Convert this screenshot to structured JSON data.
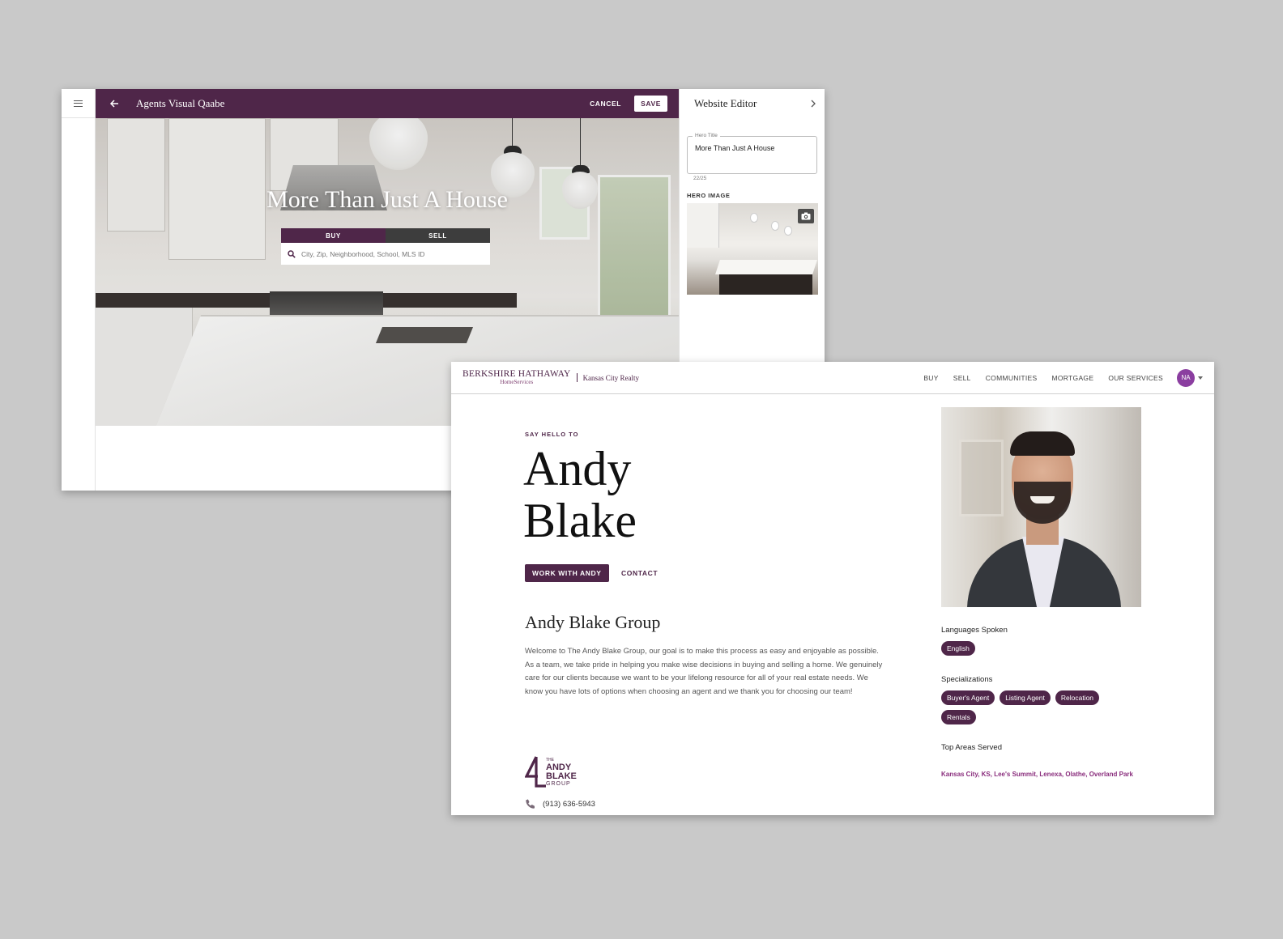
{
  "editor": {
    "title": "Agents Visual Qaabe",
    "cancel_label": "CANCEL",
    "save_label": "SAVE",
    "hero": {
      "title": "More Than Just A House",
      "buy_tab": "BUY",
      "sell_tab": "SELL",
      "search_placeholder": "City, Zip, Neighborhood, School, MLS ID"
    },
    "panel": {
      "title": "Website Editor",
      "hero_title_label": "Hero Title",
      "hero_title_value": "More Than Just A House",
      "char_count": "22/25",
      "hero_image_label": "HERO IMAGE"
    },
    "accent_color": "#4f2649"
  },
  "site": {
    "brand": {
      "name": "BERKSHIRE HATHAWAY",
      "sub": "HomeServices",
      "city": "Kansas City Realty"
    },
    "nav": [
      "BUY",
      "SELL",
      "COMMUNITIES",
      "MORTGAGE",
      "OUR SERVICES"
    ],
    "user_initials": "NA",
    "say_hello": "SAY HELLO TO",
    "first_name": "Andy",
    "last_name": "Blake",
    "work_button": "WORK WITH ANDY",
    "contact_button": "CONTACT",
    "group_title": "Andy Blake Group",
    "bio": "Welcome to The Andy Blake Group, our goal is to make this process as easy and enjoyable as possible. As a team, we take pride in helping you make wise decisions in buying and selling a home. We genuinely care for our clients because we want to be your lifelong resource for all of your real estate needs. We know you have lots of options when choosing an agent and we thank you for choosing our team!",
    "logo": {
      "the": "THE",
      "line1": "ANDY",
      "line2": "BLAKE",
      "line3": "GROUP"
    },
    "phone": "(913) 636-5943",
    "languages_label": "Languages Spoken",
    "languages": [
      "English"
    ],
    "specializations_label": "Specializations",
    "specializations": [
      "Buyer's Agent",
      "Listing Agent",
      "Relocation",
      "Rentals"
    ],
    "areas_label": "Top Areas Served",
    "areas": "Kansas City, KS, Lee's Summit, Lenexa, Olathe, Overland Park",
    "accent_color": "#4f2649",
    "avatar_color": "#8b3ea0"
  }
}
